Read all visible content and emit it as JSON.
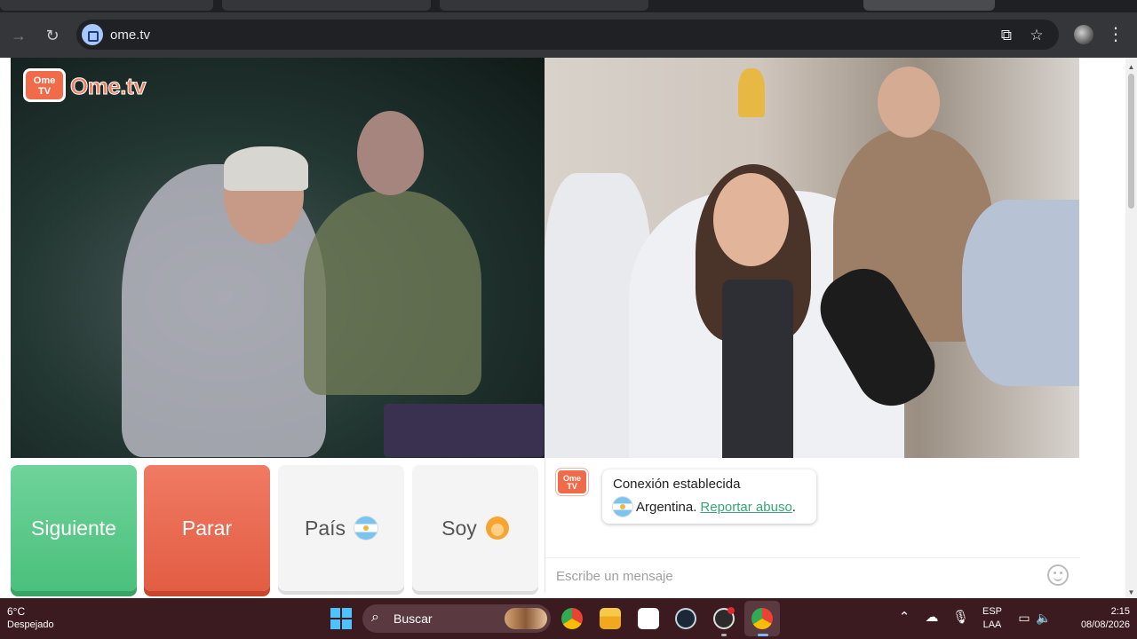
{
  "browser": {
    "url": "ome.tv",
    "icons": {
      "forward": "arrow-right-icon",
      "reload": "reload-icon",
      "site": "video-site-icon",
      "install": "install-app-icon",
      "bookmark": "star-icon",
      "menu": "three-dots-icon"
    }
  },
  "site": {
    "logo_text": "Ome.tv",
    "logo_tv_line1": "Ome",
    "logo_tv_line2": "TV",
    "brand_color": "#f06b4a"
  },
  "buttons": {
    "next": "Siguiente",
    "stop": "Parar",
    "country": "País",
    "country_flag": "flag-argentina-icon",
    "soy": "Soy",
    "soy_icon": "woman-emoji-icon",
    "next_color": "#5cc98a",
    "stop_color": "#ea6a50"
  },
  "chat": {
    "status": "Conexión establecida",
    "country": "Argentina.",
    "report_link": "Reportar abuso",
    "report_suffix": ".",
    "placeholder": "Escribe un mensaje",
    "emoji_icon": "smiley-icon"
  },
  "taskbar": {
    "temperature": "6°C",
    "weather": "Despejado",
    "search": "Buscar",
    "lang_line1": "ESP",
    "lang_line2": "LAA",
    "time": "2:15",
    "date": "08/08/2026",
    "apps": [
      "chrome-icon",
      "file-explorer-icon",
      "capcut-icon",
      "steam-icon",
      "obs-icon",
      "chrome-active-icon"
    ],
    "tray": [
      "chevron-up-icon",
      "onedrive-icon",
      "microphone-icon",
      "network-icon",
      "speaker-icon"
    ]
  }
}
